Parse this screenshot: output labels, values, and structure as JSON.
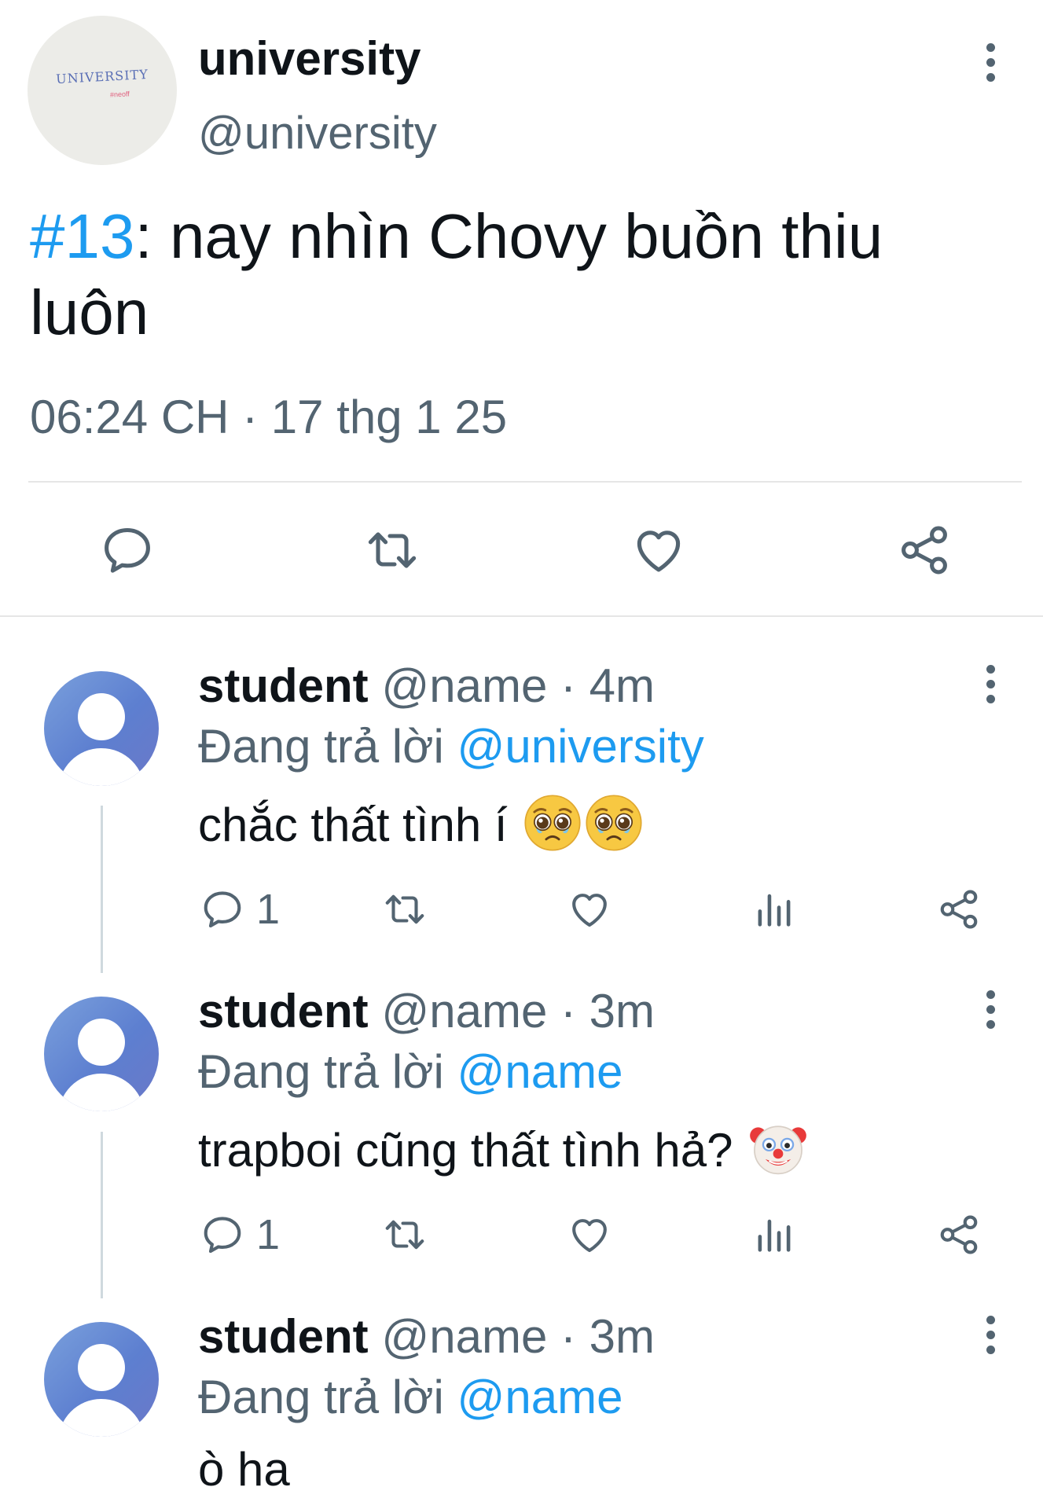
{
  "tweet": {
    "author_name": "university",
    "author_handle": "@university",
    "avatar_logo_text": "UNIVERSITY",
    "avatar_logo_sub": "#neoff",
    "hashtag": "#13",
    "text": ": nay nhìn Chovy buồn thiu luôn",
    "timestamp": "06:24 CH · 17 thg 1 25",
    "icons": [
      "reply-icon",
      "retweet-icon",
      "like-icon",
      "share-icon",
      "more-icon"
    ]
  },
  "replies": [
    {
      "name": "student",
      "handle": "@name",
      "separator": "·",
      "time": "4m",
      "replying_prefix": "Đang trả lời",
      "replying_to": "@university",
      "text": "chắc thất tình í",
      "emojis": [
        "pleading-face-emoji",
        "pleading-face-emoji"
      ],
      "reply_count": "1"
    },
    {
      "name": "student",
      "handle": "@name",
      "separator": "·",
      "time": "3m",
      "replying_prefix": "Đang trả lời",
      "replying_to": "@name",
      "text": "trapboi cũng thất tình hả?",
      "emojis": [
        "clown-face-emoji"
      ],
      "reply_count": "1"
    },
    {
      "name": "student",
      "handle": "@name",
      "separator": "·",
      "time": "3m",
      "replying_prefix": "Đang trả lời",
      "replying_to": "@name",
      "text": "ò ha"
    }
  ],
  "colors": {
    "link": "#1d9bf0",
    "secondary_text": "#536471",
    "primary_text": "#0f1419",
    "avatar_gradient_start": "#7aa0dc",
    "avatar_gradient_end": "#6b78c8"
  }
}
